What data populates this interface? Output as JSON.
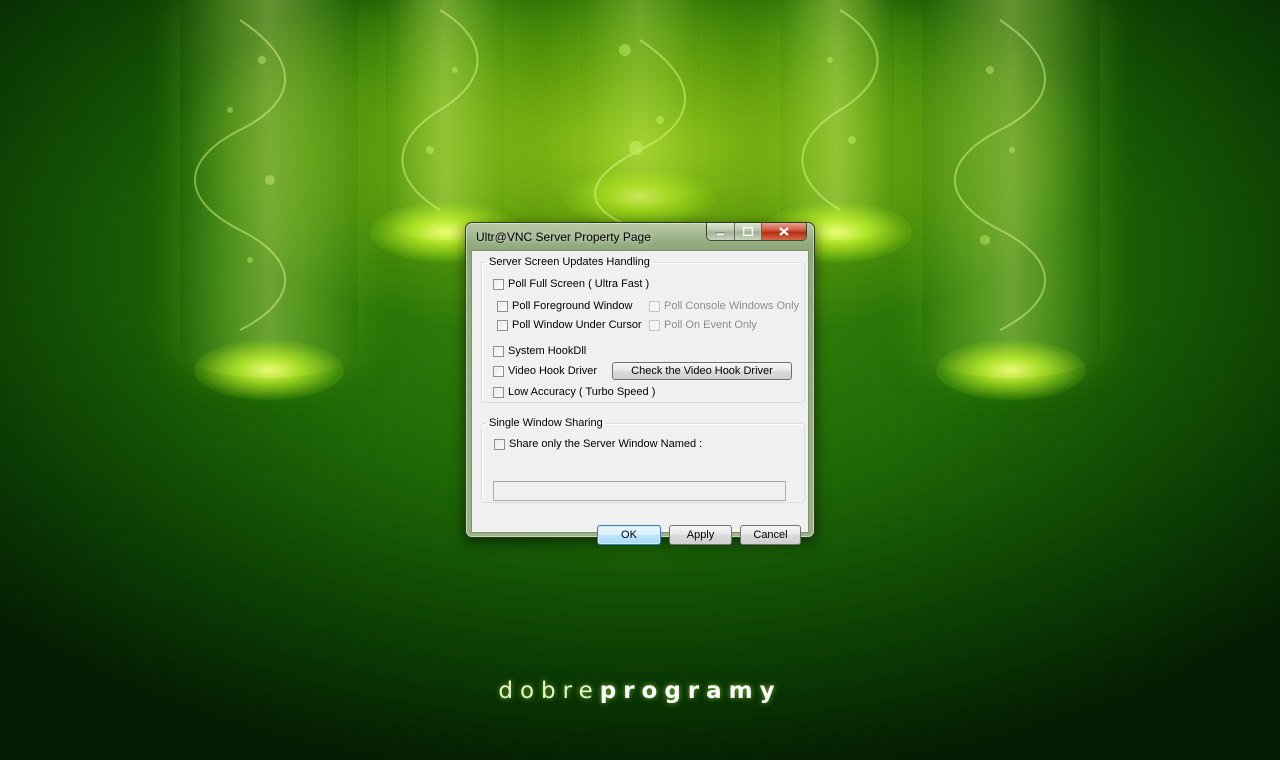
{
  "brand": {
    "regular": "dobre",
    "bold": "programy"
  },
  "window": {
    "title": "Ultr@VNC Server Property Page",
    "controls": {
      "minimize": "minimize-icon",
      "maximize": "maximize-icon",
      "close": "close-icon"
    }
  },
  "screen_updates": {
    "legend": "Server Screen Updates Handling",
    "poll_full_screen": "Poll Full Screen ( Ultra Fast )",
    "poll_foreground_window": "Poll Foreground Window",
    "poll_console_windows_only": "Poll Console Windows Only",
    "poll_window_under_cursor": "Poll Window Under Cursor",
    "poll_on_event_only": "Poll On Event Only",
    "system_hookdll": "System HookDll",
    "video_hook_driver": "Video Hook Driver",
    "check_video_hook_driver": "Check the Video Hook Driver",
    "low_accuracy": "Low Accuracy ( Turbo Speed )"
  },
  "single_window": {
    "legend": "Single Window Sharing",
    "share_only_named": "Share only the Server Window Named :",
    "window_name_value": ""
  },
  "buttons": {
    "ok": "OK",
    "apply": "Apply",
    "cancel": "Cancel"
  },
  "colors": {
    "accent": "#3c7fb1",
    "close": "#c7402a",
    "background": "#2a7a08"
  }
}
